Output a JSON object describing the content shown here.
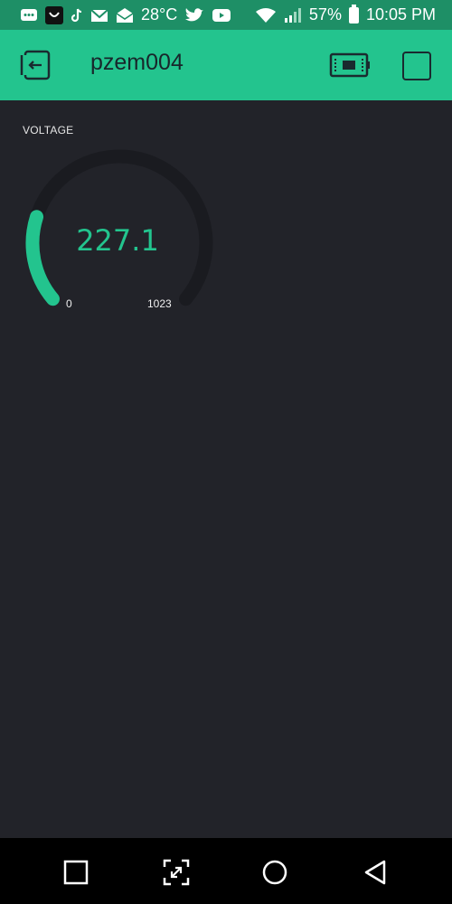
{
  "status_bar": {
    "temperature": "28°C",
    "battery_percent": "57%",
    "time": "10:05 PM",
    "icons": [
      "messages-icon",
      "notification-icon",
      "tiktok-icon",
      "gmail-icon",
      "email-icon",
      "twitter-icon",
      "youtube-icon",
      "wifi-icon",
      "signal-icon",
      "battery-icon"
    ]
  },
  "header": {
    "title": "pzem004",
    "background_color": "#23c48e"
  },
  "gauge": {
    "label": "VOLTAGE",
    "value": "227.1",
    "min": "0",
    "max": "1023",
    "fill_fraction": 0.222,
    "accent_color": "#23c48e"
  },
  "navigation_bar": {
    "buttons": [
      "recent-apps-button",
      "screenshot-button",
      "home-button",
      "back-button"
    ]
  }
}
